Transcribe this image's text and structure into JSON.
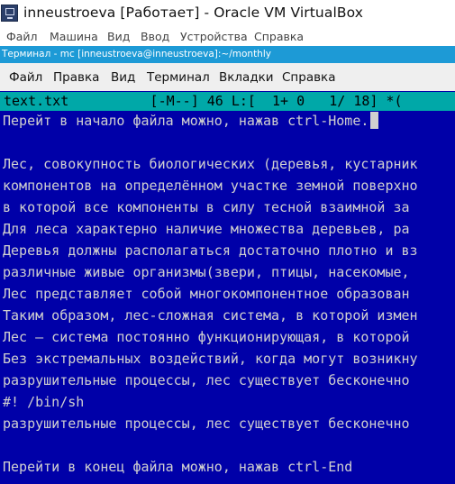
{
  "window": {
    "title": "inneustroeva [Работает] - Oracle VM VirtualBox",
    "icon": "virtualbox-icon"
  },
  "vbox_menu": [
    "Файл",
    "Машина",
    "Вид",
    "Ввод",
    "Устройства",
    "Справка"
  ],
  "guest_window": {
    "title": "Терминал - mc [inneustroeva@inneustroeva]:~/monthly"
  },
  "terminal_menu": [
    "Файл",
    "Правка",
    "Вид",
    "Терминал",
    "Вкладки",
    "Справка"
  ],
  "editor": {
    "status_line": "text.txt          [-M--] 46 L:[  1+ 0   1/ 18] *(",
    "lines": [
      "Перейт в начало файла можно, нажав ctrl-Home.",
      "",
      "Лес, совокупность биологических (деревья, кустарник",
      "компонентов на определённом участке земной поверхно",
      "в которой все компоненты в силу тесной взаимной за",
      "Для леса характерно наличие множества деревьев, ра",
      "Деревья должны располагаться достаточно плотно и вз",
      "различные живые организмы(звери, птицы, насекомые,",
      "Лес представляет собой многокомпонентное образован",
      "Таким образом, лес-сложная система, в которой измен",
      "Лес – система постоянно функционирующая, в которой",
      "Без экстремальных воздействий, когда могут возникну",
      "разрушительные процессы, лес существует бесконечно",
      "#! /bin/sh",
      "разрушительные процессы, лес существует бесконечно",
      "",
      "Перейти в конец файла можно, нажав ctrl-End"
    ]
  },
  "colors": {
    "terminal_bg": "#0000a8",
    "status_bg": "#00a8a8",
    "guest_title_bg": "#1d9ad6",
    "text": "#d0d0d0"
  }
}
